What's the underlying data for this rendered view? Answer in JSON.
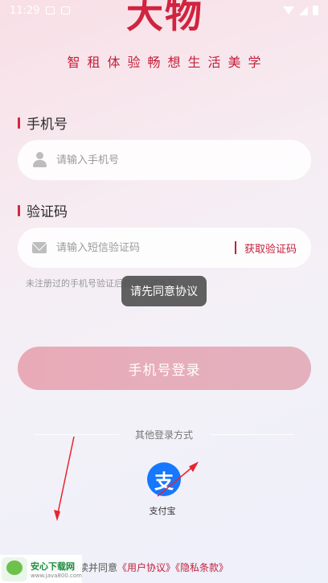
{
  "status_bar": {
    "time": "11:29"
  },
  "brand": {
    "logo_text": "大物",
    "slogan": "智租体验畅想生活美学"
  },
  "phone_field": {
    "label": "手机号",
    "placeholder": "请输入手机号"
  },
  "code_field": {
    "label": "验证码",
    "placeholder": "请输入短信验证码",
    "get_code_label": "获取验证码"
  },
  "hint": "未注册过的手机号验证后自动创建账号",
  "toast": "请先同意协议",
  "login_button": "手机号登录",
  "other_login": {
    "title": "其他登录方式",
    "alipay_icon": "支",
    "alipay_label": "支付宝"
  },
  "agreement": {
    "prefix": "仔细阅读并同意",
    "user_agreement": "《用户协议》",
    "privacy_policy": "《隐私条款》"
  },
  "watermark": {
    "title": "安心下载网",
    "url": "www.java800.com"
  },
  "colors": {
    "accent": "#c3203b",
    "login_button": "#e9aab8",
    "alipay": "#1677ff",
    "annotation_arrow": "#e8242c"
  }
}
